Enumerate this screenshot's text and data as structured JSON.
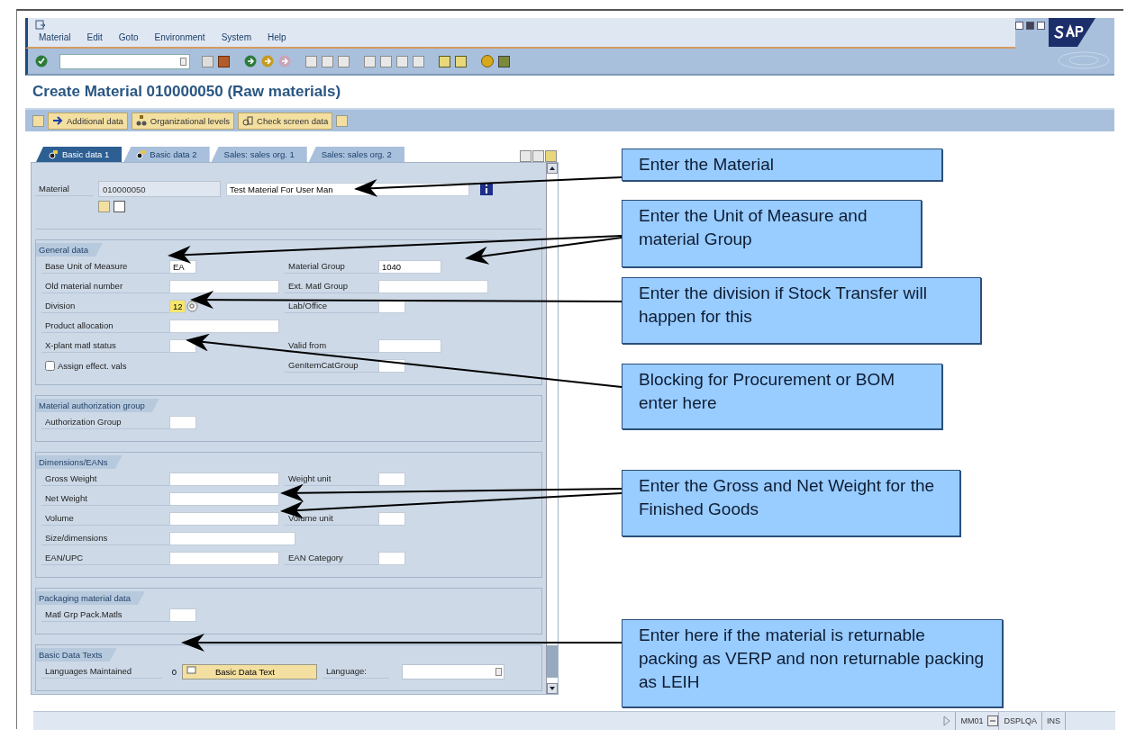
{
  "menu": [
    "Material",
    "Edit",
    "Goto",
    "Environment",
    "System",
    "Help"
  ],
  "title": "Create Material 010000050 (Raw materials)",
  "app_toolbar": [
    "Additional data",
    "Organizational levels",
    "Check screen data"
  ],
  "tabs": [
    {
      "label": "Basic data 1",
      "selected": true
    },
    {
      "label": "Basic data 2",
      "selected": false
    },
    {
      "label": "Sales: sales org. 1",
      "selected": false
    },
    {
      "label": "Sales: sales org. 2",
      "selected": false
    }
  ],
  "header": {
    "label": "Material",
    "number": "010000050",
    "description": "Test Material For User Man"
  },
  "sections": [
    {
      "title": "General data",
      "rows": [
        [
          {
            "label": "Base Unit of Measure",
            "kind": "short",
            "value": "EA"
          },
          {
            "label": "Material Group",
            "kind": "medium",
            "value": "1040"
          }
        ],
        [
          {
            "label": "Old material number",
            "kind": "long"
          },
          {
            "label": "Ext. Matl Group",
            "kind": "long"
          }
        ],
        [
          {
            "label": "Division",
            "kind": "search",
            "value": "12"
          },
          {
            "label": "Lab/Office",
            "kind": "short"
          }
        ],
        [
          {
            "label": "Product allocation",
            "kind": "long"
          }
        ],
        [
          {
            "label": "X-plant matl status",
            "kind": "short"
          },
          {
            "label": "Valid from",
            "kind": "medium"
          }
        ],
        [
          {
            "label": "Assign effect. vals",
            "kind": "checkbox",
            "checked": false
          },
          {
            "label": "GenItemCatGroup",
            "kind": "short"
          }
        ]
      ]
    },
    {
      "title": "Material authorization group",
      "rows": [
        [
          {
            "label": "Authorization Group",
            "kind": "short"
          }
        ]
      ]
    },
    {
      "title": "Dimensions/EANs",
      "rows": [
        [
          {
            "label": "Gross Weight",
            "kind": "long"
          },
          {
            "label": "Weight unit",
            "kind": "short"
          }
        ],
        [
          {
            "label": "Net Weight",
            "kind": "long"
          }
        ],
        [
          {
            "label": "Volume",
            "kind": "long"
          },
          {
            "label": "Volume unit",
            "kind": "short"
          }
        ],
        [
          {
            "label": "Size/dimensions",
            "kind": "wide"
          }
        ],
        [
          {
            "label": "EAN/UPC",
            "kind": "long"
          },
          {
            "label": "EAN Category",
            "kind": "short"
          }
        ]
      ]
    },
    {
      "title": "Packaging material data",
      "rows": [
        [
          {
            "label": "Matl Grp Pack.Matls",
            "kind": "short"
          }
        ]
      ]
    }
  ],
  "texts_section": {
    "title": "Basic Data Texts",
    "label": "Languages Maintained",
    "count": "0",
    "button": "Basic Data Text",
    "language_label": "Language:"
  },
  "status_bar": [
    "MM01",
    "DSPLQA",
    "INS"
  ],
  "callouts": [
    {
      "text": "Enter the Material"
    },
    {
      "text": "Enter the Unit of Measure and material Group"
    },
    {
      "text": "Enter the division if Stock Transfer will happen for this"
    },
    {
      "text": "Blocking for Procurement or BOM enter here"
    },
    {
      "text": "Enter the Gross and Net Weight for the Finished Goods"
    },
    {
      "text": "Enter here if the material is returnable packing as VERP and non returnable packing as LEIH"
    }
  ]
}
